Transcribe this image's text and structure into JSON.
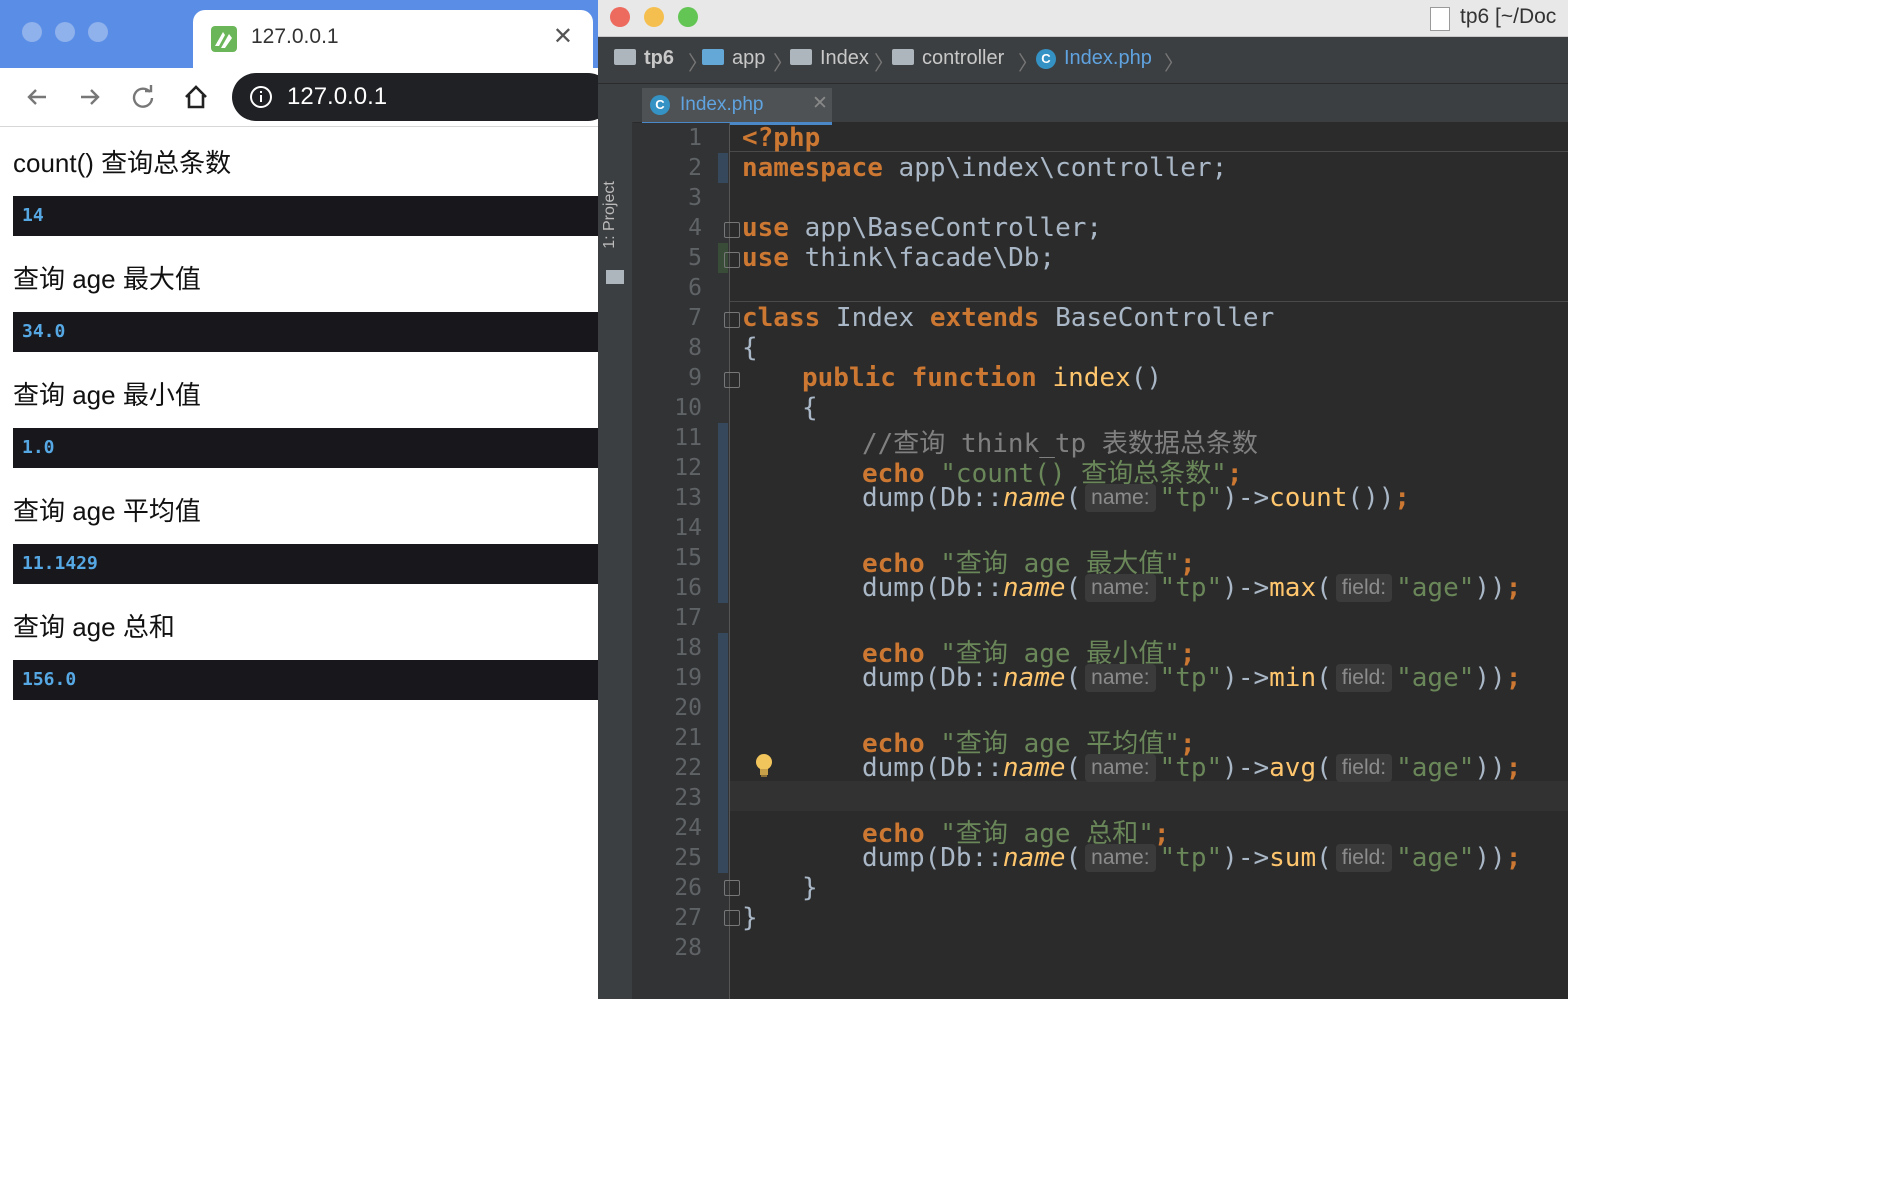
{
  "browser": {
    "tab_title": "127.0.0.1",
    "url": "127.0.0.1",
    "results": [
      {
        "heading": "count() 查询总条数",
        "value": "14"
      },
      {
        "heading": "查询 age 最大值",
        "value": "34.0"
      },
      {
        "heading": "查询 age 最小值",
        "value": "1.0"
      },
      {
        "heading": "查询 age 平均值",
        "value": "11.1429"
      },
      {
        "heading": "查询 age 总和",
        "value": "156.0"
      }
    ]
  },
  "ide": {
    "window_title": "tp6 [~/Doc",
    "breadcrumbs": [
      "tp6",
      "app",
      "Index",
      "controller",
      "Index.php"
    ],
    "side_panel": "1: Project",
    "editor_tab": "Index.php",
    "line_numbers": [
      "1",
      "2",
      "3",
      "4",
      "5",
      "6",
      "7",
      "8",
      "9",
      "10",
      "11",
      "12",
      "13",
      "14",
      "15",
      "16",
      "17",
      "18",
      "19",
      "20",
      "21",
      "22",
      "23",
      "24",
      "25",
      "26",
      "27",
      "28"
    ],
    "code": {
      "l1": "<?php",
      "l2_kw": "namespace",
      "l2_rest": " app\\index\\controller;",
      "l4_kw": "use",
      "l4_rest": " app\\BaseController;",
      "l5_kw": "use",
      "l5_rest": " think\\facade\\Db;",
      "l7_kw1": "class",
      "l7_name": " Index ",
      "l7_kw2": "extends",
      "l7_rest": " BaseController",
      "l8": "{",
      "l9_kw1": "public",
      "l9_kw2": "function",
      "l9_fn": "index",
      "l9_rest": "()",
      "l10": "{",
      "l11": "//查询 think_tp 表数据总条数",
      "echo": "echo",
      "l12_str": "\"count() 查询总条数\"",
      "l15_str": "\"查询 age 最大值\"",
      "l18_str": "\"查询 age 最小值\"",
      "l21_str": "\"查询 age 平均值\"",
      "l24_str": "\"查询 age 总和\"",
      "dump_pre": "dump(Db::",
      "name_call": "name",
      "hint_name": "name:",
      "hint_field": "field:",
      "tp_str": "\"tp\"",
      "age_str": "\"age\"",
      "count_fn": "count",
      "max_fn": "max",
      "min_fn": "min",
      "avg_fn": "avg",
      "sum_fn": "sum",
      "l26": "}",
      "l27": "}"
    }
  }
}
